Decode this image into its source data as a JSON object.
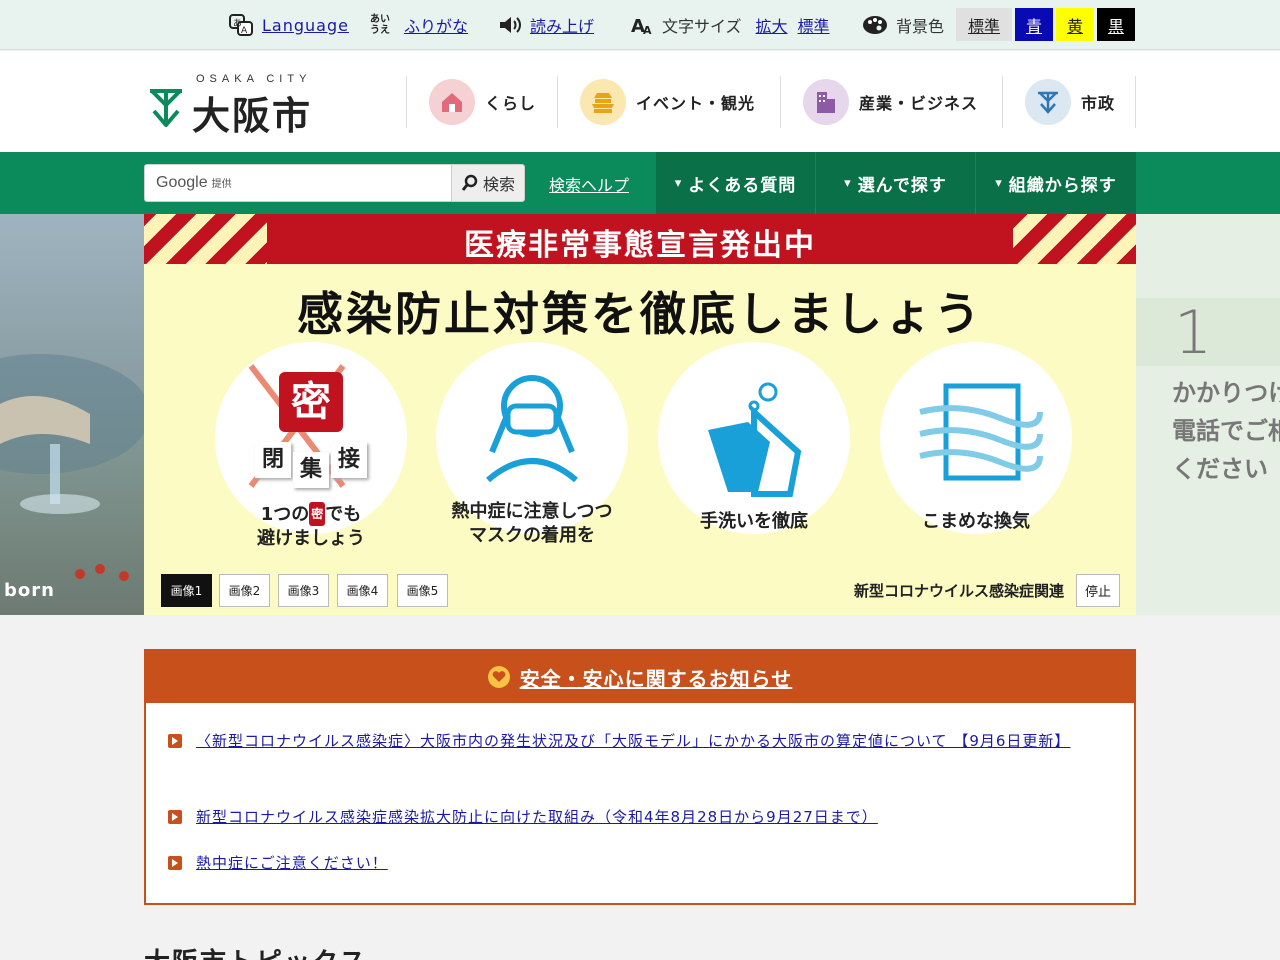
{
  "utility": {
    "language": "Language",
    "furigana": "ふりがな",
    "read_aloud": "読み上げ",
    "font_size_label": "文字サイズ",
    "enlarge": "拡大",
    "standard": "標準",
    "bg_color_label": "背景色",
    "bg_options": [
      "標準",
      "青",
      "黄",
      "黒"
    ],
    "furigana_icon_text": "あいうえ"
  },
  "logo": {
    "en": "OSAKA CITY",
    "jp": "大阪市"
  },
  "global_nav": [
    {
      "label": "くらし",
      "icon": "house-icon",
      "color": "#f6d1d4"
    },
    {
      "label": "イベント・観光",
      "icon": "castle-icon",
      "color": "#fbe8b0"
    },
    {
      "label": "産業・ビジネス",
      "icon": "building-icon",
      "color": "#e6d7ec"
    },
    {
      "label": "市政",
      "icon": "city-mark-icon",
      "color": "#dbe7f1"
    }
  ],
  "search": {
    "provider": "Google",
    "provider_suffix": "提供",
    "placeholder": "",
    "button": "検索",
    "help": "検索ヘルプ"
  },
  "green_tabs": [
    "よくある質問",
    "選んで探す",
    "組織から探す"
  ],
  "slider": {
    "banner": "医療非常事態宣言発出中",
    "headline": "感染防止対策を徹底しましょう",
    "cards": [
      {
        "cap_pre": "1つの",
        "cap_mitsu": "密",
        "cap_post": "でも",
        "cap_line2": "避けましょう",
        "mitsu_big": "密",
        "mitsu_words": [
          "閉",
          "集",
          "接"
        ]
      },
      {
        "cap_line1": "熱中症に注意しつつ",
        "cap_line2": "マスクの着用を"
      },
      {
        "cap_line1": "手洗いを徹底"
      },
      {
        "cap_line1": "こまめな換気"
      }
    ],
    "image_buttons": [
      "画像1",
      "画像2",
      "画像3",
      "画像4",
      "画像5"
    ],
    "active_index": 0,
    "caption": "新型コロナウイルス感染症関連",
    "stop": "停止",
    "left_peek_text": "born",
    "right_peek_num": "1",
    "right_peek_lines": [
      "かかりつけ",
      "電話でご相",
      "ください"
    ]
  },
  "notice": {
    "title": "安全・安心に関するお知らせ",
    "items": [
      "〈新型コロナウイルス感染症〉大阪市内の発生状況及び「大阪モデル」にかかる大阪市の算定値について 【9月6日更新】",
      "新型コロナウイルス感染症感染拡大防止に向けた取組み（令和4年8月28日から9月27日まで）",
      "熱中症にご注意ください！"
    ]
  },
  "topics_heading": "大阪市トピックス",
  "colors": {
    "green": "#0b8a5c",
    "dark_green": "#0a7048",
    "orange": "#c8501a",
    "red": "#c1121f",
    "slide_bg": "#fdfbc4"
  }
}
